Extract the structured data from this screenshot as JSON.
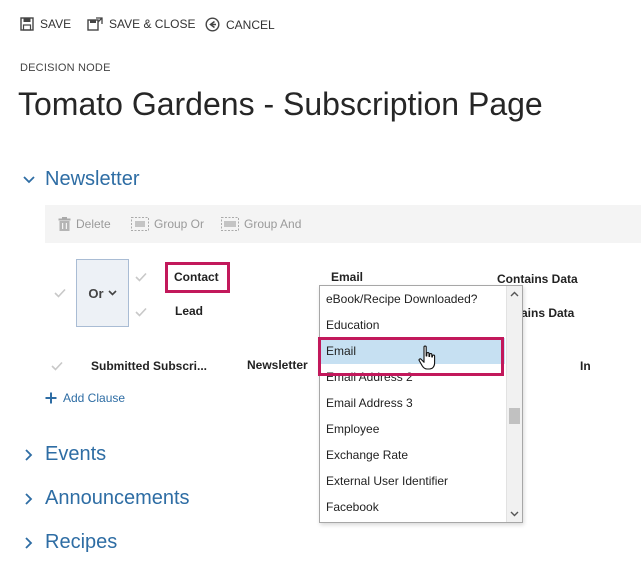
{
  "toolbar": {
    "save": "SAVE",
    "save_close": "SAVE & CLOSE",
    "cancel": "CANCEL"
  },
  "page": {
    "subheading": "DECISION NODE",
    "title": "Tomato Gardens - Subscription Page"
  },
  "sections": {
    "newsletter": "Newsletter",
    "events": "Events",
    "announcements": "Announcements",
    "recipes": "Recipes"
  },
  "clause_toolbar": {
    "delete": "Delete",
    "group_or": "Group Or",
    "group_and": "Group And"
  },
  "group": {
    "operator": "Or",
    "rows": [
      {
        "entity": "Contact",
        "field": "Email",
        "operator": "Contains Data"
      },
      {
        "entity": "Lead",
        "operator": "ains Data"
      }
    ]
  },
  "clause2": {
    "entity": "Submitted Subscri...",
    "field": "Newsletter",
    "operator": "In"
  },
  "add_clause": "Add Clause",
  "dropdown": {
    "items": [
      "eBook/Recipe Downloaded?",
      "Education",
      "Email",
      "Email Address 2",
      "Email Address 3",
      "Employee",
      "Exchange Rate",
      "External User Identifier",
      "Facebook"
    ],
    "selected": "Email"
  },
  "colors": {
    "accent": "#2e6da4",
    "highlight": "#c2185b",
    "selected_bg": "#c6e0f2"
  }
}
